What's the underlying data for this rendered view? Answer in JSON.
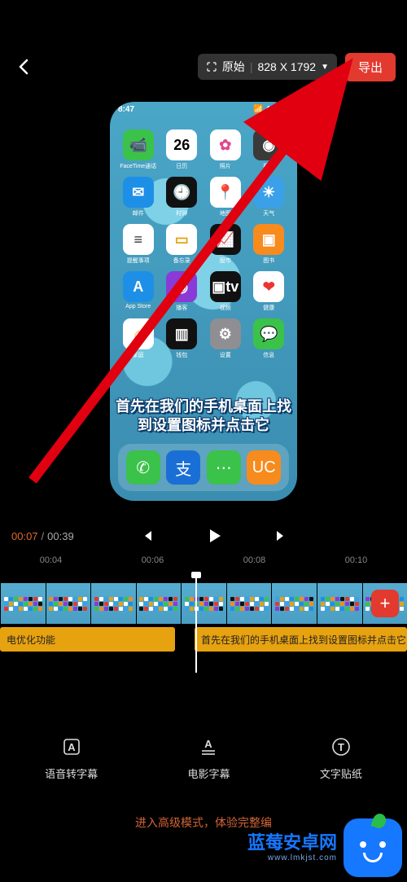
{
  "header": {
    "ratio_label": "原始",
    "resolution": "828 X 1792",
    "export_label": "导出"
  },
  "preview": {
    "status_time": "8:47",
    "status_net": "📶 4G 🔋",
    "apps": [
      {
        "label": "FaceTime通话",
        "bg": "#3bc24a",
        "glyph": "📹"
      },
      {
        "label": "日历",
        "bg": "#ffffff",
        "glyph": "26",
        "fg": "#000"
      },
      {
        "label": "照片",
        "bg": "#ffffff",
        "glyph": "✿",
        "fg": "#e04a8a"
      },
      {
        "label": "相机",
        "bg": "#3a3a3a",
        "glyph": "◉"
      },
      {
        "label": "邮件",
        "bg": "#1e8fe6",
        "glyph": "✉"
      },
      {
        "label": "时钟",
        "bg": "#111",
        "glyph": "🕘"
      },
      {
        "label": "地图",
        "bg": "#fff",
        "glyph": "📍",
        "fg": "#2a7"
      },
      {
        "label": "天气",
        "bg": "#3aa0e8",
        "glyph": "☀"
      },
      {
        "label": "提醒事项",
        "bg": "#fff",
        "glyph": "≡",
        "fg": "#333"
      },
      {
        "label": "备忘录",
        "bg": "#fff",
        "glyph": "▭",
        "fg": "#e7a210"
      },
      {
        "label": "股市",
        "bg": "#111",
        "glyph": "📈"
      },
      {
        "label": "图书",
        "bg": "#f78b1e",
        "glyph": "▣"
      },
      {
        "label": "App Store",
        "bg": "#1e8fe6",
        "glyph": "A"
      },
      {
        "label": "播客",
        "bg": "#8a3ad6",
        "glyph": "◉"
      },
      {
        "label": "视频",
        "bg": "#111",
        "glyph": "▣tv",
        "fg": "#fff"
      },
      {
        "label": "健康",
        "bg": "#fff",
        "glyph": "❤",
        "fg": "#e33"
      },
      {
        "label": "家庭",
        "bg": "#fff",
        "glyph": "⌂",
        "fg": "#f5a623"
      },
      {
        "label": "钱包",
        "bg": "#111",
        "glyph": "▥"
      },
      {
        "label": "设置",
        "bg": "#8e8e93",
        "glyph": "⚙"
      },
      {
        "label": "信息",
        "bg": "#3bc24a",
        "glyph": "💬"
      }
    ],
    "caption": "首先在我们的手机桌面上找到设置图标并点击它",
    "dock": [
      {
        "bg": "#3bc24a",
        "glyph": "✆"
      },
      {
        "bg": "#1a6fd6",
        "glyph": "支",
        "fg": "#fff"
      },
      {
        "bg": "#3bc24a",
        "glyph": "⋯"
      },
      {
        "bg": "#f78b1e",
        "glyph": "UC",
        "fg": "#fff"
      }
    ]
  },
  "playback": {
    "current": "00:07",
    "separator": "/",
    "total": "00:39"
  },
  "ruler": [
    "00:04",
    "00:06",
    "00:08",
    "00:10"
  ],
  "subtitle_track": {
    "seg1": "电优化功能",
    "seg2": "首先在我们的手机桌面上找到设置图标并点击它"
  },
  "tools": [
    {
      "key": "voice",
      "label": "语音转字幕"
    },
    {
      "key": "movie",
      "label": "电影字幕"
    },
    {
      "key": "sticker",
      "label": "文字贴纸"
    }
  ],
  "footer_tip": "进入高级模式，体验完整编",
  "watermark": {
    "name": "蓝莓安卓网",
    "url": "www.lmkjst.com"
  }
}
